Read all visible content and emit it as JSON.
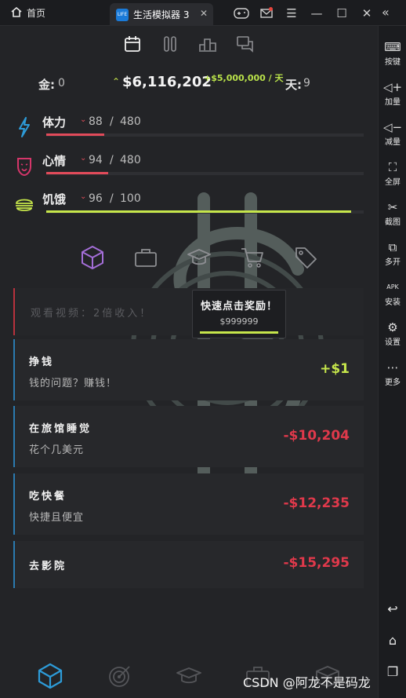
{
  "titlebar": {
    "home_label": "首页",
    "active_tab_label": "生活模拟器 3",
    "app_icon_text": "LIFE"
  },
  "sidebar": {
    "items": [
      {
        "label": "按键",
        "icon": "keyboard-icon"
      },
      {
        "label": "加量",
        "icon": "volume-up-icon"
      },
      {
        "label": "减量",
        "icon": "volume-down-icon"
      },
      {
        "label": "全屏",
        "icon": "fullscreen-icon"
      },
      {
        "label": "截图",
        "icon": "scissors-icon"
      },
      {
        "label": "多开",
        "icon": "multi-instance-icon"
      },
      {
        "label": "安装",
        "icon": "apk-icon"
      },
      {
        "label": "设置",
        "icon": "gear-icon"
      },
      {
        "label": "更多",
        "icon": "more-icon"
      }
    ]
  },
  "stats": {
    "gold_label": "金:",
    "gold_value": "0",
    "money": "$6,116,202",
    "rate": "+$5,000,000 / 天",
    "day_label": "天:",
    "day_value": "9"
  },
  "bars": [
    {
      "label": "体力",
      "current": "88",
      "sep": "/",
      "max": "480",
      "fraction": 0.183,
      "color": "#e14b5a",
      "icon": "lightning-icon"
    },
    {
      "label": "心情",
      "current": "94",
      "sep": "/",
      "max": "480",
      "fraction": 0.196,
      "color": "#e14b5a",
      "icon": "mask-icon"
    },
    {
      "label": "饥饿",
      "current": "96",
      "sep": "/",
      "max": "100",
      "fraction": 0.96,
      "color": "#c6e64b",
      "icon": "burger-icon"
    }
  ],
  "ad_card": {
    "text": "观看视频：2倍收入！"
  },
  "popup": {
    "title": "快速点击奖励！",
    "value": "$999999"
  },
  "cards": [
    {
      "title": "挣钱",
      "desc": "钱的问题？赚钱！",
      "value": "+$1",
      "color": "#c6e64b"
    },
    {
      "title": "在旅馆睡觉",
      "desc": "花个几美元",
      "value": "-$10,204",
      "color": "#e0394b"
    },
    {
      "title": "吃快餐",
      "desc": "快捷且便宜",
      "value": "-$12,235",
      "color": "#e0394b"
    },
    {
      "title": "去影院",
      "desc": "",
      "value": "-$15,295",
      "color": "#e0394b"
    }
  ],
  "watermark": "CSDN @阿龙不是码龙",
  "colors": {
    "accent_lime": "#c6e64b",
    "accent_red": "#e0394b",
    "accent_blue": "#2a7bb0",
    "accent_purple": "#a46ed8"
  }
}
